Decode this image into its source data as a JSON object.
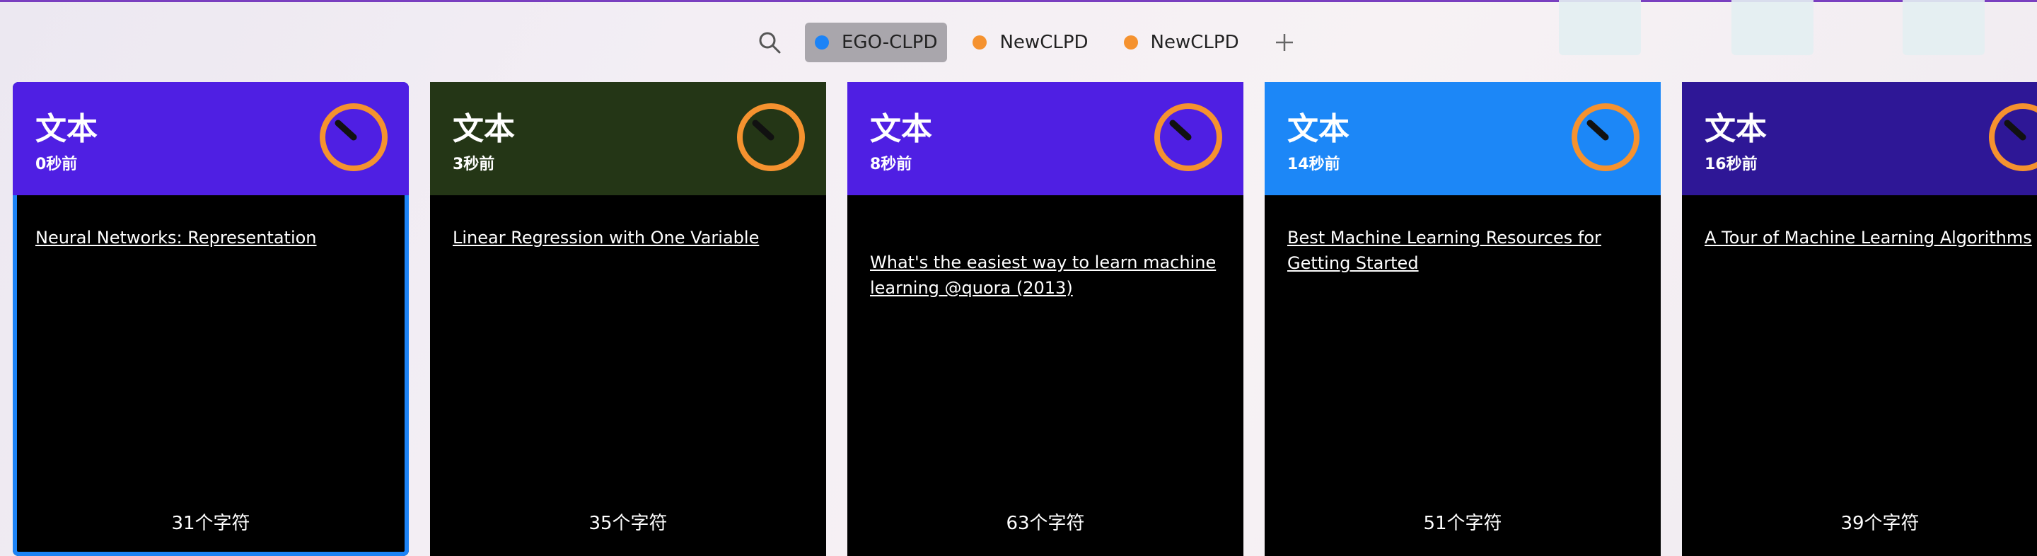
{
  "toolbar": {
    "tabs": [
      {
        "label": "EGO-CLPD",
        "dot_color": "#1c83f6",
        "active": true
      },
      {
        "label": "NewCLPD",
        "dot_color": "#f5922f",
        "active": false
      },
      {
        "label": "NewCLPD",
        "dot_color": "#f5922f",
        "active": false
      }
    ]
  },
  "cards": [
    {
      "title": "文本",
      "time": "0秒前",
      "text": "Neural Networks: Representation",
      "count": "31个字符",
      "header_color": "#4f1fe3",
      "selected": true
    },
    {
      "title": "文本",
      "time": "3秒前",
      "text": "Linear Regression with One Variable",
      "count": "35个字符",
      "header_color": "#243616",
      "selected": false
    },
    {
      "title": "文本",
      "time": "8秒前",
      "text": "What's the easiest way to learn machine learning @quora (2013)",
      "count": "63个字符",
      "header_color": "#4f1fe3",
      "selected": false
    },
    {
      "title": "文本",
      "time": "14秒前",
      "text": "Best Machine Learning Resources for Getting Started",
      "count": "51个字符",
      "header_color": "#1c87f7",
      "selected": false
    },
    {
      "title": "文本",
      "time": "16秒前",
      "text": "A Tour of Machine Learning Algorithms",
      "count": "39个字符",
      "header_color": "#2e1796",
      "selected": false
    }
  ],
  "colors": {
    "accent": "#1c83f6",
    "timer": "#f5922f"
  }
}
